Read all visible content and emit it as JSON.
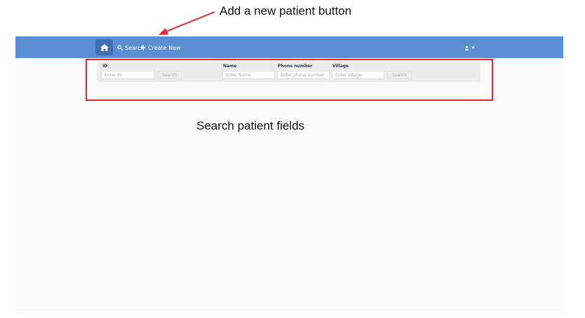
{
  "annotations": {
    "top_caption": "Add a new patient button",
    "bottom_caption": "Search patient fields",
    "color": "#e8262b"
  },
  "navbar": {
    "color": "#5b8fd3",
    "home_icon": "home-icon",
    "search_label": "Search",
    "search_icon": "search-icon",
    "create_label": "Create New",
    "create_icon": "plus-icon",
    "user_icon": "user-icon",
    "user_caret_icon": "caret-down-icon"
  },
  "search_panel": {
    "id_label": "ID",
    "id_placeholder": "Enter ID",
    "id_search_button": "Search",
    "name_label": "Name",
    "name_placeholder": "Enter Name",
    "phone_label": "Phone number",
    "phone_placeholder": "Enter phone number",
    "village_label": "Village",
    "village_placeholder": "Enter village",
    "search_button": "Search"
  }
}
